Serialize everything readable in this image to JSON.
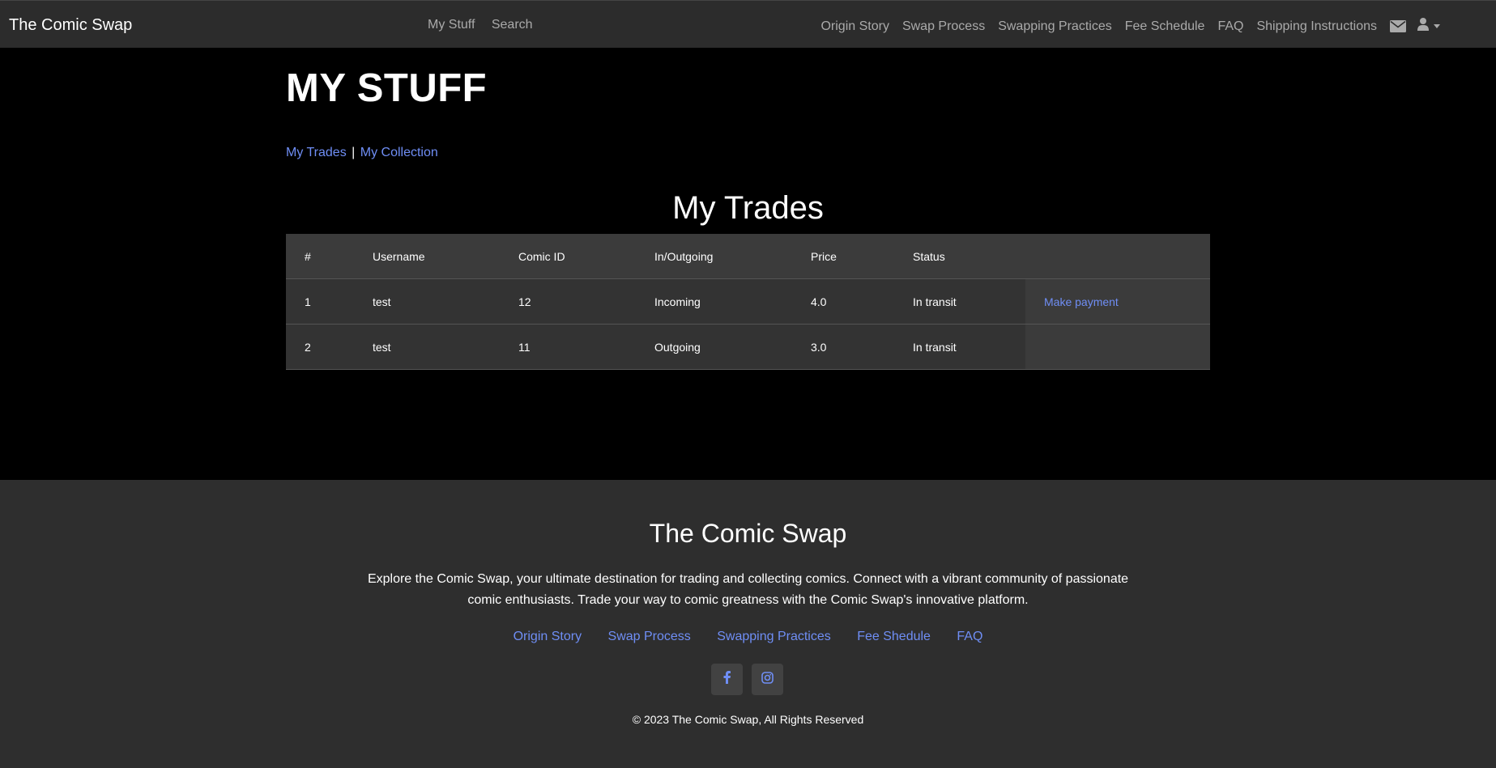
{
  "navbar": {
    "brand": "The Comic Swap",
    "center_links": [
      "My Stuff",
      "Search"
    ],
    "right_links": [
      "Origin Story",
      "Swap Process",
      "Swapping Practices",
      "Fee Schedule",
      "FAQ",
      "Shipping Instructions"
    ],
    "icons": [
      "envelope-icon",
      "user-icon"
    ]
  },
  "page": {
    "title": "MY STUFF",
    "subnav": {
      "trades": "My Trades",
      "separator": "|",
      "collection": "My Collection"
    },
    "section_title": "My Trades"
  },
  "trades_table": {
    "headers": [
      "#",
      "Username",
      "Comic ID",
      "In/Outgoing",
      "Price",
      "Status",
      ""
    ],
    "rows": [
      {
        "num": "1",
        "username": "test",
        "comic_id": "12",
        "direction": "Incoming",
        "price": "4.0",
        "status": "In transit",
        "action": "Make payment"
      },
      {
        "num": "2",
        "username": "test",
        "comic_id": "11",
        "direction": "Outgoing",
        "price": "3.0",
        "status": "In transit",
        "action": ""
      }
    ]
  },
  "footer": {
    "title": "The Comic Swap",
    "description": "Explore the Comic Swap, your ultimate destination for trading and collecting comics. Connect with a vibrant community of passionate comic enthusiasts. Trade your way to comic greatness with the Comic Swap's innovative platform.",
    "links": [
      "Origin Story",
      "Swap Process",
      "Swapping Practices",
      "Fee Shedule",
      "FAQ"
    ],
    "social": [
      "facebook-icon",
      "instagram-icon"
    ],
    "copyright": "© 2023 The Comic Swap, All Rights Reserved"
  },
  "colors": {
    "link": "#6f8ef5",
    "navbar_bg": "#2c2c2c",
    "footer_bg": "#2e2e2e",
    "table_bg": "#3b3b3b"
  }
}
